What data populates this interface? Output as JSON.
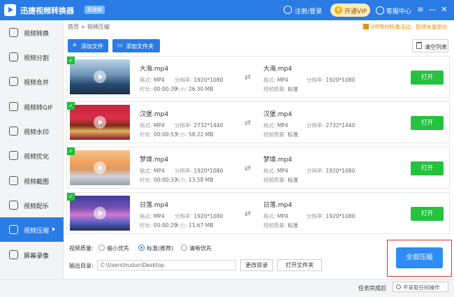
{
  "app": {
    "title": "迅捷视频转换器",
    "badge": "极速版",
    "login": "注册/登录",
    "vip": "开通VIP",
    "service": "客服中心"
  },
  "window": {
    "menu": "≡",
    "minimize": "—",
    "close": "✕"
  },
  "sidebar": {
    "items": [
      {
        "label": "视频转换",
        "icon": "video-convert-icon"
      },
      {
        "label": "视频分割",
        "icon": "video-split-icon"
      },
      {
        "label": "视频合并",
        "icon": "video-merge-icon"
      },
      {
        "label": "视频转GIF",
        "icon": "gif-icon"
      },
      {
        "label": "视频水印",
        "icon": "watermark-icon"
      },
      {
        "label": "视频优化",
        "icon": "optimize-icon"
      },
      {
        "label": "视频截图",
        "icon": "screenshot-icon"
      },
      {
        "label": "视频配乐",
        "icon": "music-icon"
      },
      {
        "label": "视频压缩",
        "icon": "compress-icon",
        "active": true
      },
      {
        "label": "屏幕录像",
        "icon": "record-icon"
      }
    ]
  },
  "breadcrumb": {
    "home": "首页",
    "sep": ">",
    "current": "视频压缩"
  },
  "notice": "VIP限时特惠活动，即将恢复原价",
  "toolbar": {
    "add_file": "添加文件",
    "add_folder": "添加文件夹",
    "clear_list": "清空列表"
  },
  "labels": {
    "format": "格式:",
    "resolution": "分辨率:",
    "duration": "时长:",
    "size": "大小:",
    "video_quality": "视频质量:",
    "quality_value": "标准",
    "open": "打开"
  },
  "files": [
    {
      "name": "大海.mp4",
      "format": "MP4",
      "resolution": "1920*1080",
      "duration": "00:00:39",
      "size": "26.30 MB",
      "out_name": "大海.mp4",
      "out_format": "MP4",
      "out_resolution": "1920*1080"
    },
    {
      "name": "汉堡.mp4",
      "format": "MP4",
      "resolution": "2732*1440",
      "duration": "00:00:53",
      "size": "58.22 MB",
      "out_name": "汉堡.mp4",
      "out_format": "MP4",
      "out_resolution": "2732*1440"
    },
    {
      "name": "梦境.mp4",
      "format": "MP4",
      "resolution": "1920*1080",
      "duration": "00:00:33",
      "size": "13.58 MB",
      "out_name": "梦境.mp4",
      "out_format": "MP4",
      "out_resolution": "1920*1080"
    },
    {
      "name": "日落.mp4",
      "format": "MP4",
      "resolution": "1920*1080",
      "duration": "00:00:29",
      "size": "11.67 MB",
      "out_name": "日落.mp4",
      "out_format": "MP4",
      "out_resolution": "1920*1080"
    }
  ],
  "quality": {
    "label": "视频质量:",
    "options": [
      "缩小优先",
      "标准(推荐)",
      "清晰优先"
    ],
    "selected": "标准(推荐)"
  },
  "output": {
    "label": "输出目录:",
    "path": "C:\\Users\\hudun\\Desktop",
    "change": "更改目录",
    "open_folder": "打开文件夹"
  },
  "compress_all": "全部压缩",
  "status": {
    "after_label": "任务完成后",
    "after_value": "不采取任何操作"
  },
  "colors": {
    "primary": "#2a7be4",
    "green": "#24c23f",
    "highlight": "#e0302a"
  }
}
